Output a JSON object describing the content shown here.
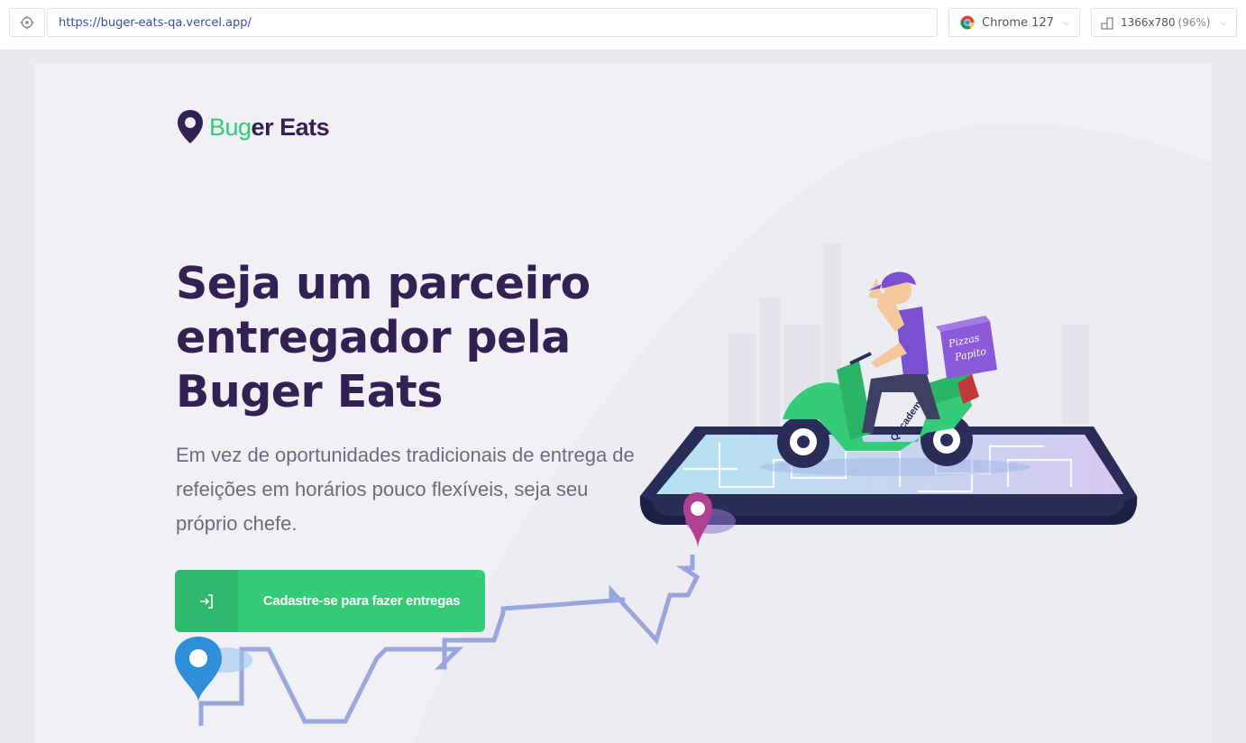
{
  "browser": {
    "url": "https://buger-eats-qa.vercel.app/",
    "browser_name": "Chrome 127",
    "resolution": "1366x780",
    "zoom": "(96%)"
  },
  "logo": {
    "part1": "Bug",
    "part2": "er Eats"
  },
  "hero": {
    "title_line1": "Seja um parceiro",
    "title_line2": "entregador pela",
    "title_line3": "Buger Eats",
    "description_line1": "Em vez de oportunidades tradicionais de entrega de",
    "description_line2": "refeições em horários pouco flexíveis, seja seu",
    "description_line3": "próprio chefe.",
    "cta_label": "Cadastre-se para fazer entregas"
  },
  "illustration": {
    "box_line1": "Pizzas",
    "box_line2": "Papito",
    "scooter_brand": "QAcademy"
  },
  "colors": {
    "primary_green": "#34cb79",
    "dark_purple": "#322153",
    "text_gray": "#6c6c80",
    "background": "#f0f0f5"
  }
}
